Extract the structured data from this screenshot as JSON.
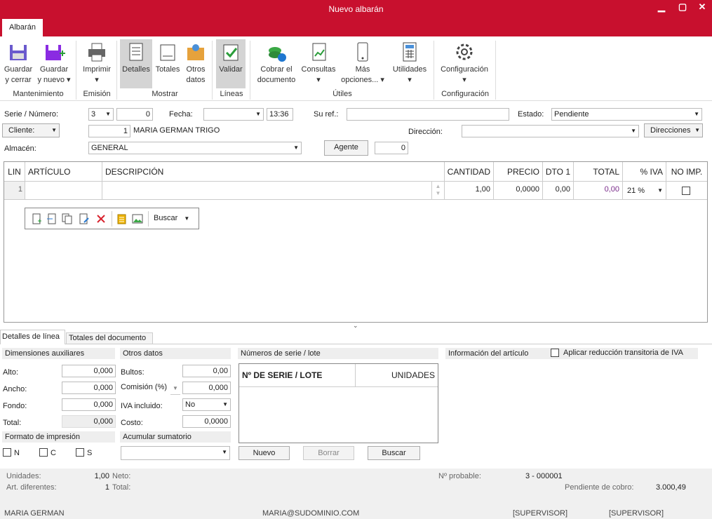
{
  "window": {
    "title": "Nuevo albarán",
    "minimize": "▁",
    "maximize": "▢",
    "close": "✕"
  },
  "tab": "Albarán",
  "ribbon": {
    "guardar_cerrar": "Guardar\ny cerrar",
    "guardar_nuevo": "Guardar\ny nuevo ▾",
    "imprimir": "Imprimir\n▾",
    "detalles": "Detalles",
    "totales": "Totales",
    "otros_datos": "Otros\ndatos",
    "validar": "Validar",
    "cobrar": "Cobrar el\ndocumento",
    "consultas": "Consultas\n▾",
    "mas_opciones": "Más\nopciones... ▾",
    "utilidades": "Utilidades\n▾",
    "configuracion": "Configuración\n▾",
    "groups": {
      "mantenimiento": "Mantenimiento",
      "emision": "Emisión",
      "mostrar": "Mostrar",
      "lineas": "Líneas",
      "utiles": "Útiles",
      "configuracion": "Configuración"
    }
  },
  "header": {
    "serie_label": "Serie / Número:",
    "serie": "3",
    "numero": "0",
    "fecha_label": "Fecha:",
    "fecha": "",
    "hora": "13:36",
    "suref_label": "Su ref.:",
    "suref": "",
    "estado_label": "Estado:",
    "estado": "Pendiente",
    "cliente_label": "Cliente:",
    "cliente_num": "1",
    "cliente_nombre": "MARIA GERMAN TRIGO",
    "direccion_label": "Dirección:",
    "direccion": "",
    "direcciones_btn": "Direcciones",
    "almacen_label": "Almacén:",
    "almacen": "GENERAL",
    "agente_btn": "Agente",
    "agente": "0"
  },
  "grid": {
    "headers": [
      "LIN",
      "ARTÍCULO",
      "DESCRIPCIÓN",
      "CANTIDAD",
      "PRECIO",
      "DTO 1",
      "TOTAL",
      "% IVA",
      "NO IMP."
    ],
    "row": {
      "lin": "1",
      "articulo": "",
      "descripcion": "",
      "cantidad": "1,00",
      "precio": "0,0000",
      "dto": "0,00",
      "total": "0,00",
      "iva": "21 %"
    },
    "buscar": "Buscar"
  },
  "bottom_tabs": {
    "detalles": "Detalles de línea",
    "totales": "Totales del documento"
  },
  "dimensiones": {
    "title": "Dimensiones auxiliares",
    "alto_label": "Alto:",
    "alto": "0,000",
    "ancho_label": "Ancho:",
    "ancho": "0,000",
    "fondo_label": "Fondo:",
    "fondo": "0,000",
    "total_label": "Total:",
    "total": "0,000"
  },
  "otros": {
    "title": "Otros datos",
    "bultos_label": "Bultos:",
    "bultos": "0,00",
    "comision_label": "Comisión (%)",
    "comision": "0,000",
    "iva_label": "IVA incluido:",
    "iva": "No",
    "costo_label": "Costo:",
    "costo": "0,0000"
  },
  "formato": {
    "title": "Formato de impresión",
    "n": "N",
    "c": "C",
    "s": "S"
  },
  "acumular": {
    "title": "Acumular sumatorio"
  },
  "series": {
    "title": "Números de serie / lote",
    "col1": "Nº DE SERIE / LOTE",
    "col2": "UNIDADES",
    "nuevo": "Nuevo",
    "borrar": "Borrar",
    "buscar": "Buscar"
  },
  "info": {
    "title": "Información del artículo",
    "aplicar": "Aplicar reducción transitoria de IVA"
  },
  "status": {
    "unidades_label": "Unidades:",
    "unidades": "1,00",
    "neto_label": "Neto:",
    "art_label": "Art. diferentes:",
    "art": "1",
    "total_label": "Total:",
    "nprob_label": "Nº probable:",
    "nprob": "3 - 000001",
    "pend_label": "Pendiente de cobro:",
    "pend": "3.000,49",
    "user": "MARIA GERMAN",
    "email": "MARIA@SUDOMINIO.COM",
    "role1": "[SUPERVISOR]",
    "role2": "[SUPERVISOR]"
  }
}
